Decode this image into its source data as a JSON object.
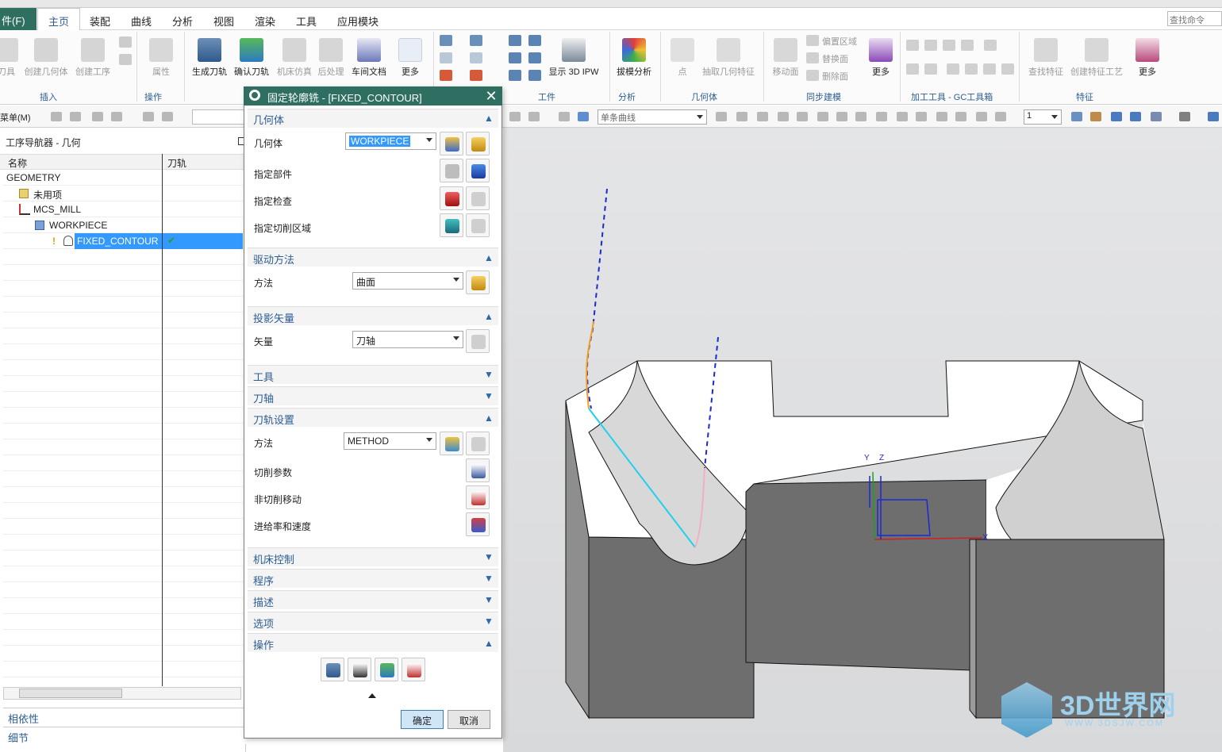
{
  "menubar": {
    "file": "件(F)",
    "tabs": [
      "主页",
      "装配",
      "曲线",
      "分析",
      "视图",
      "渲染",
      "工具",
      "应用模块"
    ],
    "search_placeholder": "查找命令"
  },
  "ribbon": {
    "insert": {
      "items": [
        "刀具",
        "创建几何体",
        "创建工序"
      ],
      "group": "插入"
    },
    "operate": {
      "items": [
        "属性"
      ],
      "group": "操作"
    },
    "main": {
      "items": [
        "生成刀轨",
        "确认刀轨",
        "机床仿真",
        "后处理",
        "车间文档",
        "更多"
      ]
    },
    "workpiece": {
      "items": [
        "显示 3D IPW"
      ],
      "group": "工件"
    },
    "analysis": {
      "items": [
        "拔模分析"
      ],
      "group": "分析"
    },
    "geometry": {
      "items": [
        "点",
        "抽取几何特征"
      ],
      "group": "几何体"
    },
    "sync": {
      "items": [
        "移动面",
        "偏置区域",
        "替换面",
        "删除面",
        "更多"
      ],
      "group": "同步建模"
    },
    "gc": {
      "group": "加工工具 - GC工具箱"
    },
    "feature": {
      "items": [
        "查找特征",
        "创建特征工艺",
        "更多"
      ],
      "group": "特征"
    }
  },
  "toolbar2": {
    "menu": "菜单(M)",
    "filter": "单条曲线",
    "zoom": "1"
  },
  "navigator": {
    "title": "工序导航器 - 几何",
    "columns": [
      "名称",
      "刀轨"
    ],
    "rows": [
      {
        "name": "GEOMETRY"
      },
      {
        "name": "未用项"
      },
      {
        "name": "MCS_MILL"
      },
      {
        "name": "WORKPIECE"
      },
      {
        "name": "FIXED_CONTOUR",
        "status": "✔"
      }
    ],
    "dependencies": "相依性",
    "details": "细节"
  },
  "dialog": {
    "title": "固定轮廓铣 - [FIXED_CONTOUR]",
    "geometry": {
      "header": "几何体",
      "geom_label": "几何体",
      "geom_value": "WORKPIECE",
      "part": "指定部件",
      "check": "指定检查",
      "cut": "指定切削区域"
    },
    "drive": {
      "header": "驱动方法",
      "method_label": "方法",
      "method_value": "曲面"
    },
    "proj": {
      "header": "投影矢量",
      "vector_label": "矢量",
      "vector_value": "刀轴"
    },
    "tool": {
      "header": "工具"
    },
    "axis": {
      "header": "刀轴"
    },
    "path": {
      "header": "刀轨设置",
      "method_label": "方法",
      "method_value": "METHOD",
      "cut_params": "切削参数",
      "non_cut": "非切削移动",
      "feeds": "进给率和速度"
    },
    "machine": {
      "header": "机床控制"
    },
    "program": {
      "header": "程序"
    },
    "desc": {
      "header": "描述"
    },
    "options": {
      "header": "选项"
    },
    "actions": {
      "header": "操作"
    },
    "ok": "确定",
    "cancel": "取消"
  },
  "viewport": {
    "axis_labels": [
      "Y",
      "Z",
      "X"
    ],
    "watermark": "3D世界网",
    "watermark_url": "WWW.3DSJW.COM"
  }
}
